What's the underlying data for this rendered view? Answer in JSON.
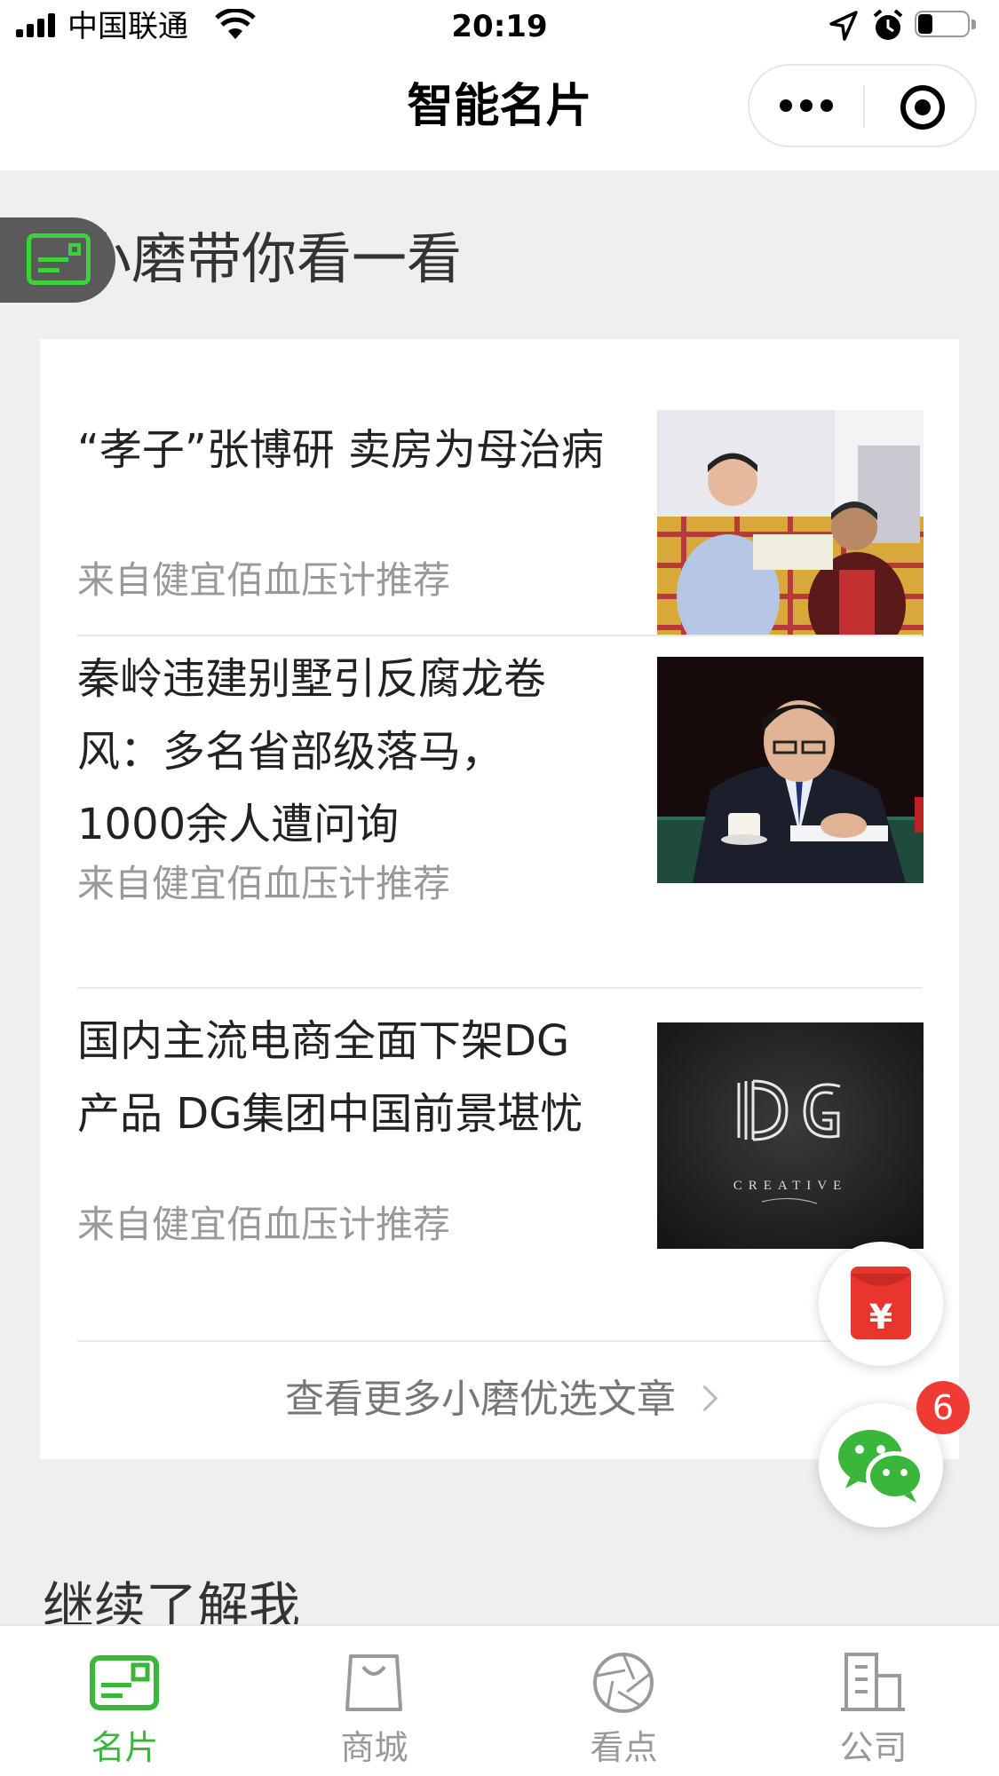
{
  "status_bar": {
    "carrier": "中国联通",
    "time": "20:19",
    "battery_level": 0.3
  },
  "nav": {
    "title": "智能名片"
  },
  "section": {
    "title": "小磨带你看一看"
  },
  "articles": [
    {
      "title": "“孝子”张博研 卖房为母治病",
      "source": "来自健宜佰血压计推荐",
      "thumb": "photo-two-people-sitting"
    },
    {
      "title": "秦岭违建别墅引反腐龙卷风：多名省部级落马，1000余人遭问询",
      "source": "来自健宜佰血压计推荐",
      "thumb": "photo-man-signing-document"
    },
    {
      "title": "国内主流电商全面下架DG产品 DG集团中国前景堪忧",
      "source": "来自健宜佰血压计推荐",
      "thumb": "dg-creative-logo",
      "thumb_text": "CREATIVE"
    }
  ],
  "more_link": "查看更多小磨优选文章",
  "floating": {
    "wechat_badge": "6"
  },
  "continue": {
    "title": "继续了解我"
  },
  "tabs": [
    {
      "label": "名片",
      "icon": "card-icon",
      "active": true
    },
    {
      "label": "商城",
      "icon": "shopping-bag-icon",
      "active": false
    },
    {
      "label": "看点",
      "icon": "aperture-icon",
      "active": false
    },
    {
      "label": "公司",
      "icon": "building-icon",
      "active": false
    }
  ],
  "colors": {
    "accent_green": "#3ab73a",
    "badge_red": "#f03b35",
    "red_packet": "#e8362e"
  }
}
